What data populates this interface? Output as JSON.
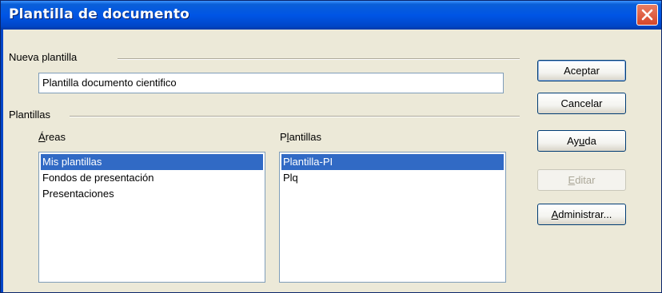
{
  "window": {
    "title": "Plantilla de documento"
  },
  "new_template": {
    "group_label": "Nueva plantilla",
    "name_value": "Plantilla documento cientifico"
  },
  "templates": {
    "group_label": "Plantillas",
    "areas": {
      "label_underlined": "Á",
      "label_rest": "reas",
      "items": [
        "Mis plantillas",
        "Fondos de presentación",
        "Presentaciones"
      ],
      "selected_index": 0
    },
    "plantillas": {
      "label_pre": "P",
      "label_underlined": "l",
      "label_rest": "antillas",
      "items": [
        "Plantilla-PI",
        "Plq"
      ],
      "selected_index": 0
    }
  },
  "buttons": {
    "accept": "Aceptar",
    "cancel": "Cancelar",
    "help_pre": "Ay",
    "help_underlined": "u",
    "help_rest": "da",
    "edit_underlined": "E",
    "edit_rest": "ditar",
    "manage_underlined": "A",
    "manage_rest": "dministrar..."
  },
  "colors": {
    "selection": "#316ac5",
    "titlebar": "#0055e5",
    "dialog_bg": "#ece9d8"
  }
}
